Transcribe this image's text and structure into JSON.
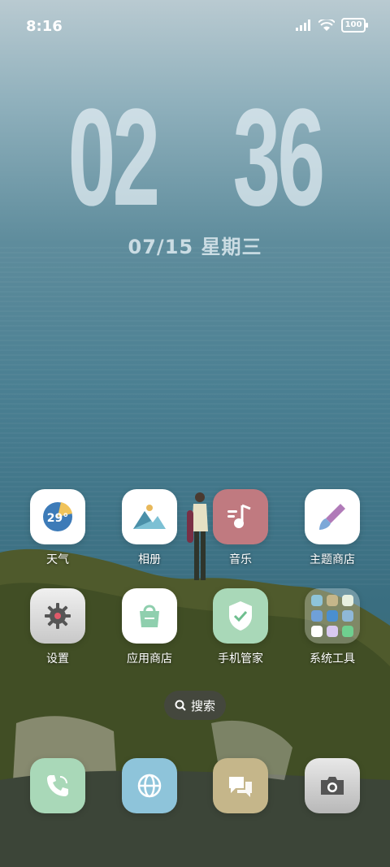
{
  "status": {
    "time": "8:16",
    "battery": "100"
  },
  "clock": {
    "hours": "02",
    "minutes": "36",
    "date": "07/15 星期三"
  },
  "apps_row1": [
    {
      "label": "天气",
      "icon": "weather-icon",
      "temp": "29°"
    },
    {
      "label": "相册",
      "icon": "gallery-icon"
    },
    {
      "label": "音乐",
      "icon": "music-icon"
    },
    {
      "label": "主题商店",
      "icon": "theme-store-icon"
    }
  ],
  "apps_row2": [
    {
      "label": "设置",
      "icon": "gear-icon"
    },
    {
      "label": "应用商店",
      "icon": "app-store-icon"
    },
    {
      "label": "手机管家",
      "icon": "shield-icon"
    },
    {
      "label": "系统工具",
      "icon": "folder-icon"
    }
  ],
  "search": {
    "label": "搜索"
  },
  "dock": [
    {
      "icon": "phone-icon"
    },
    {
      "icon": "browser-icon"
    },
    {
      "icon": "messages-icon"
    },
    {
      "icon": "camera-icon"
    }
  ],
  "colors": {
    "weather_bg": "#ffffff",
    "music_bg": "#c07a80",
    "shield_bg": "#a9d8b8",
    "phone_bg": "#a9d8b8",
    "browser_bg": "#8ec4da",
    "messages_bg": "#c5b68a",
    "camera_bg": "#d0d0d0"
  }
}
